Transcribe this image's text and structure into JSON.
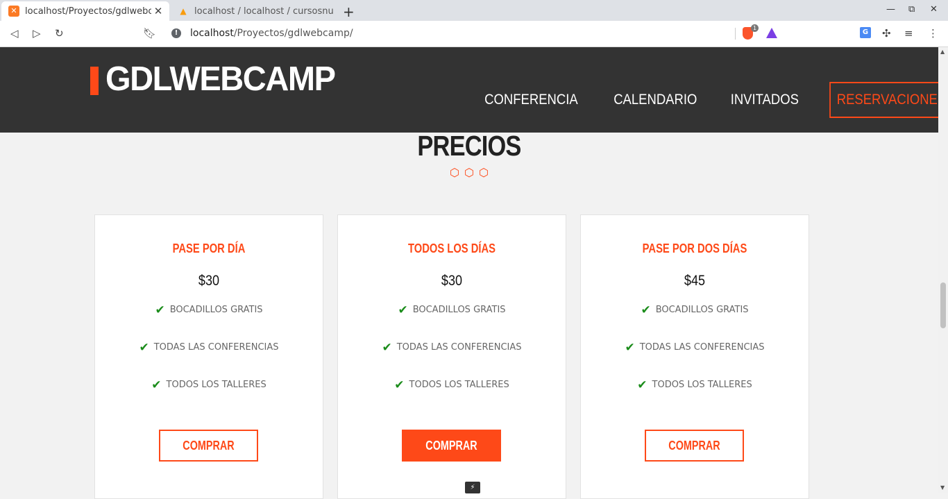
{
  "browser": {
    "tabs": [
      {
        "title": "localhost/Proyectos/gdlwebc",
        "favicon": "xampp-icon"
      },
      {
        "title": "localhost / localhost / cursosnu",
        "favicon": "phpmyadmin-icon"
      }
    ],
    "url_host": "localhost",
    "url_path": "/Proyectos/gdlwebcamp/",
    "brave_badge_count": "1"
  },
  "site": {
    "logo": "GDLWEBCAMP",
    "nav": [
      "CONFERENCIA",
      "CALENDARIO",
      "INVITADOS",
      "RESERVACIONES"
    ],
    "accent_color": "#fe4918"
  },
  "section": {
    "title": "PRECIOS"
  },
  "plans": [
    {
      "name": "PASE POR DÍA",
      "price": "$30",
      "features": [
        "BOCADILLOS GRATIS",
        "TODAS LAS CONFERENCIAS",
        "TODOS LOS TALLERES"
      ],
      "button": "COMPRAR"
    },
    {
      "name": "TODOS LOS DÍAS",
      "price": "$30",
      "features": [
        "BOCADILLOS GRATIS",
        "TODAS LAS CONFERENCIAS",
        "TODOS LOS TALLERES"
      ],
      "button": "COMPRAR"
    },
    {
      "name": "PASE POR DOS DÍAS",
      "price": "$45",
      "features": [
        "BOCADILLOS GRATIS",
        "TODAS LAS CONFERENCIAS",
        "TODOS LOS TALLERES"
      ],
      "button": "COMPRAR"
    }
  ]
}
